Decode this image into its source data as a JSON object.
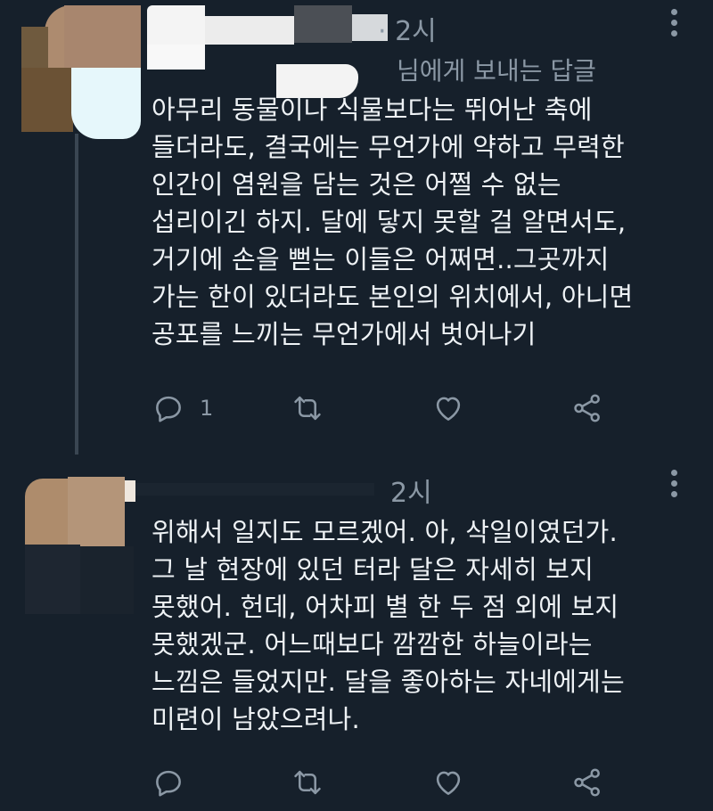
{
  "tweets": [
    {
      "time": "· 2시",
      "reply_to": "님에게 보내는 답글",
      "lines": [
        "아무리 동물이나 식물보다는 뛰어난 축에",
        "들더라도, 결국에는 무언가에 약하고 무력한",
        "인간이 염원을 담는 것은 어쩔 수 없는",
        "섭리이긴 하지. 달에 닿지 못할 걸 알면서도,",
        "거기에 손을 뻗는 이들은 어쩌면..그곳까지",
        "가는 한이 있더라도 본인의 위치에서, 아니면",
        "공포를 느끼는 무언가에서 벗어나기"
      ],
      "reply_count": "1",
      "icons": [
        "reply-icon",
        "retweet-icon",
        "like-icon",
        "share-icon",
        "more-icon"
      ]
    },
    {
      "time": "2시",
      "lines": [
        "위해서 일지도 모르겠어. 아, 삭일이였던가.",
        "그 날 현장에 있던 터라 달은 자세히 보지",
        "못했어. 헌데, 어차피 별 한 두 점 외에 보지",
        "못했겠군. 어느때보다 깜깜한 하늘이라는",
        "느낌은 들었지만. 달을 좋아하는 자네에게는",
        "미련이 남았으려나."
      ],
      "reply_count": "",
      "icons": [
        "reply-icon",
        "retweet-icon",
        "like-icon",
        "share-icon",
        "more-icon"
      ]
    }
  ],
  "colors": {
    "background": "#16202b",
    "text": "#eef2f5",
    "muted": "#8b98a5",
    "thread_line": "#3a4652"
  }
}
